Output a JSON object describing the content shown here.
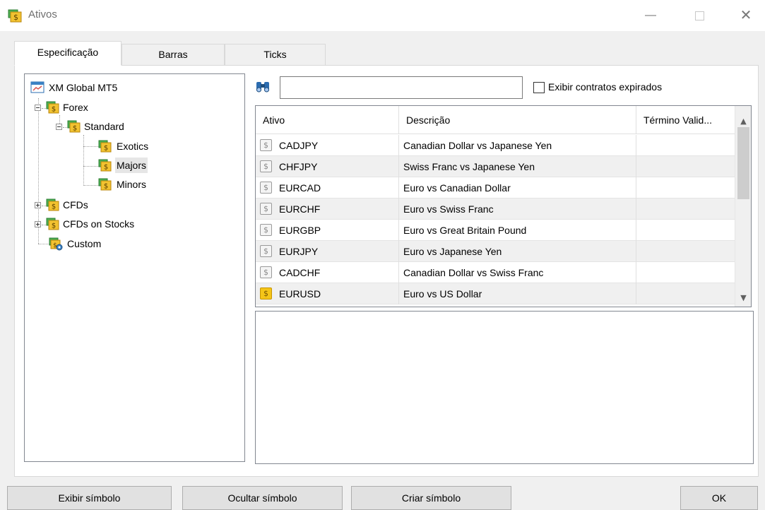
{
  "window": {
    "title": "Ativos",
    "app_icon": "assets-folder-icon",
    "controls": {
      "minimize": "—",
      "maximize": "",
      "close": "✕"
    }
  },
  "tabs": [
    {
      "label": "Especificação",
      "active": true
    },
    {
      "label": "Barras",
      "active": false
    },
    {
      "label": "Ticks",
      "active": false
    }
  ],
  "tree": {
    "root": "XM Global MT5",
    "nodes": [
      {
        "label": "Forex"
      },
      {
        "label": "Standard"
      },
      {
        "label": "Exotics"
      },
      {
        "label": "Majors",
        "selected": true
      },
      {
        "label": "Minors"
      },
      {
        "label": "CFDs"
      },
      {
        "label": "CFDs on Stocks"
      },
      {
        "label": "Custom"
      }
    ]
  },
  "search": {
    "icon": "binoculars-icon",
    "value": "",
    "expired_checkbox_label": "Exibir contratos expirados",
    "expired_checked": false
  },
  "table": {
    "columns": [
      "Ativo",
      "Descrição",
      "Término Valid..."
    ],
    "rows": [
      {
        "symbol": "CADJPY",
        "description": "Canadian Dollar vs Japanese Yen",
        "expiry": "",
        "active": false
      },
      {
        "symbol": "CHFJPY",
        "description": "Swiss Franc vs Japanese Yen",
        "expiry": "",
        "active": false
      },
      {
        "symbol": "EURCAD",
        "description": "Euro vs Canadian Dollar",
        "expiry": "",
        "active": false
      },
      {
        "symbol": "EURCHF",
        "description": "Euro vs Swiss Franc",
        "expiry": "",
        "active": false
      },
      {
        "symbol": "EURGBP",
        "description": "Euro vs Great Britain Pound",
        "expiry": "",
        "active": false
      },
      {
        "symbol": "EURJPY",
        "description": "Euro vs Japanese Yen",
        "expiry": "",
        "active": false
      },
      {
        "symbol": "CADCHF",
        "description": "Canadian Dollar vs Swiss Franc",
        "expiry": "",
        "active": false
      },
      {
        "symbol": "EURUSD",
        "description": "Euro vs US Dollar",
        "expiry": "",
        "active": true
      }
    ],
    "badge_glyph": "$"
  },
  "buttons": {
    "show_symbol": "Exibir símbolo",
    "hide_symbol": "Ocultar símbolo",
    "create_symbol": "Criar símbolo",
    "ok": "OK"
  },
  "colors": {
    "folder_yellow": "#f2c230",
    "folder_green": "#4caf50",
    "active_symbol": "#f5c518",
    "selection_bg": "#e6e6e6"
  }
}
